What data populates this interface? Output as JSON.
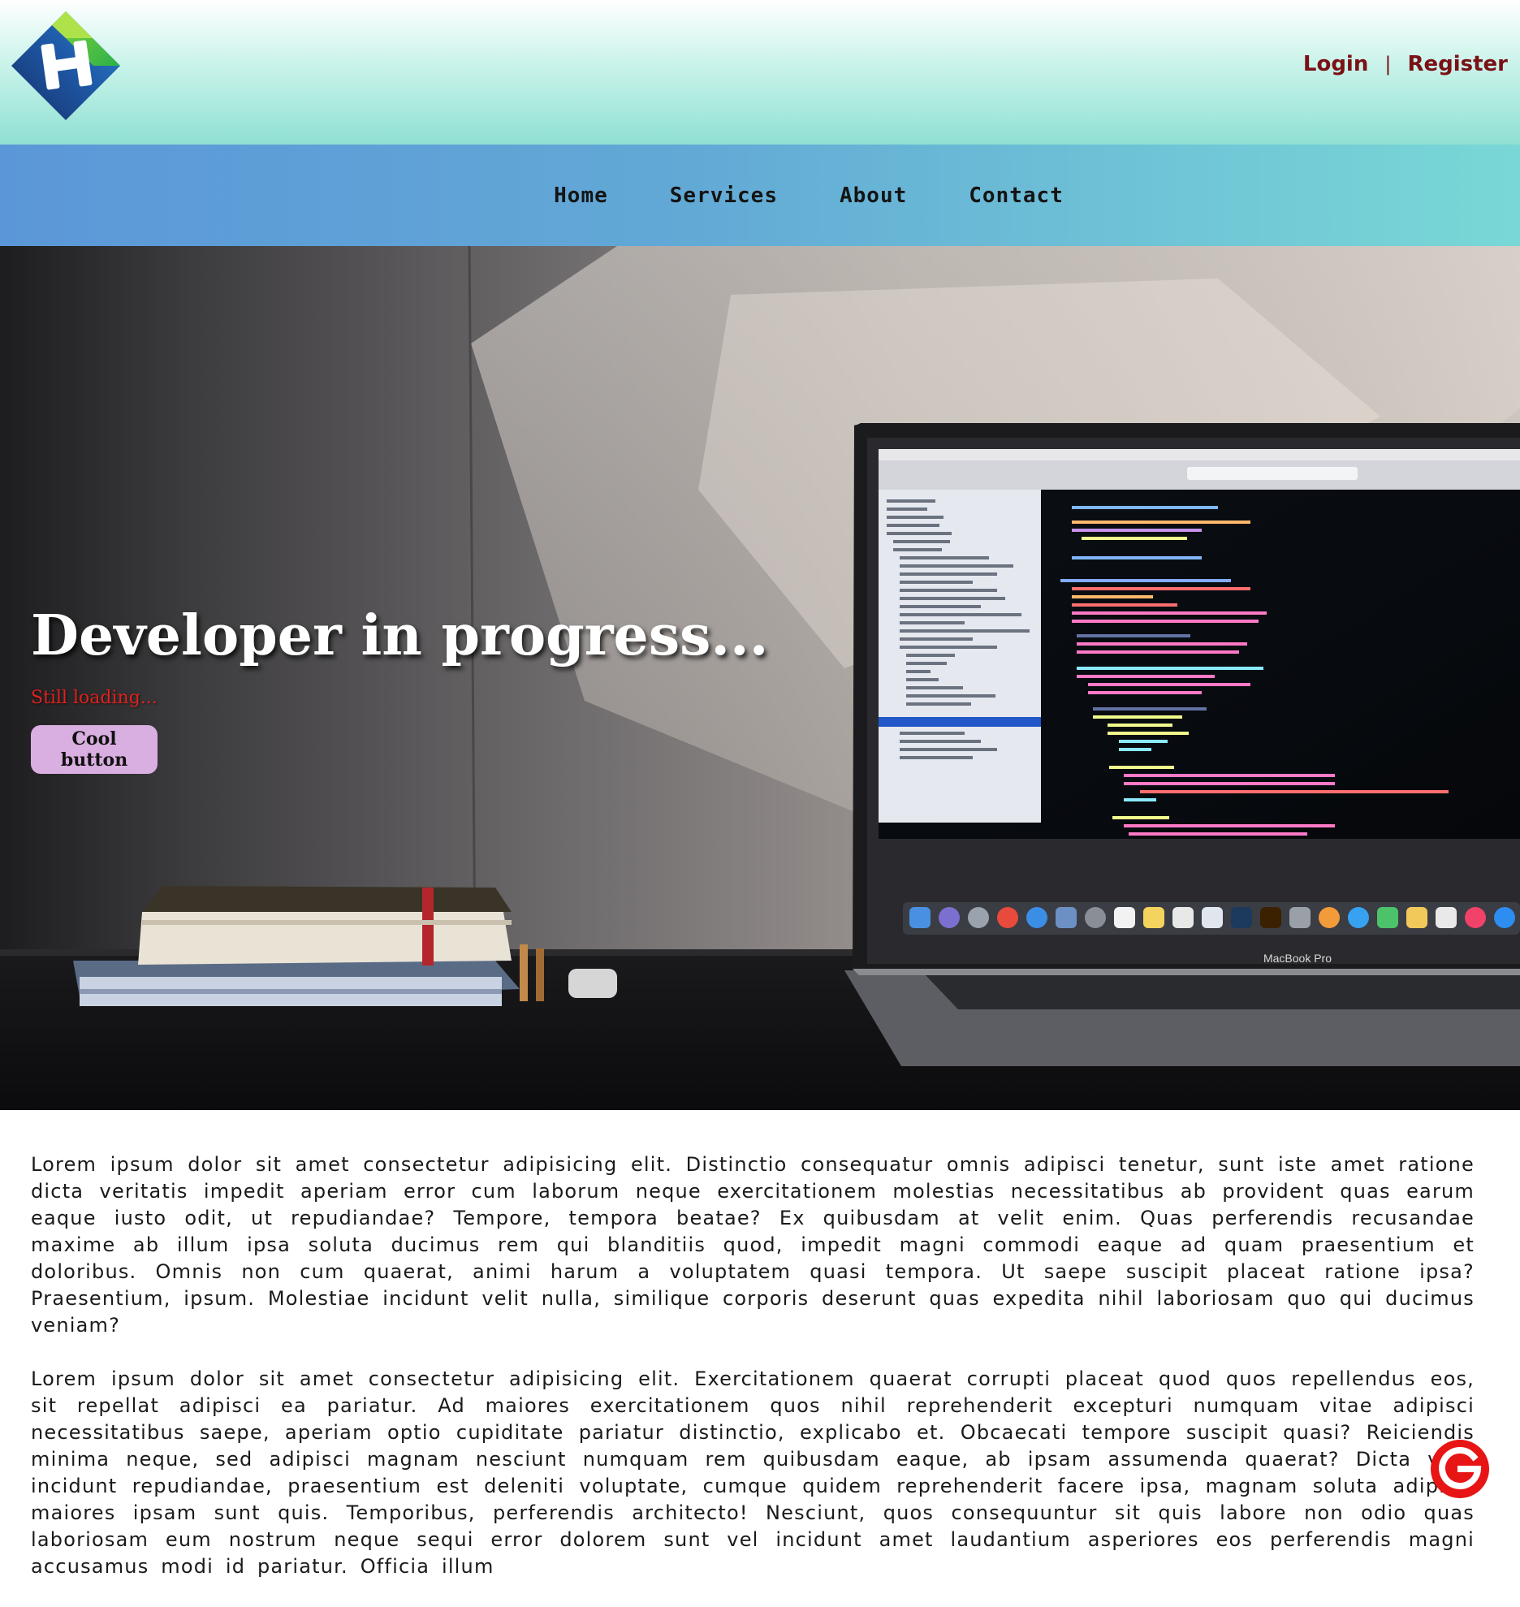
{
  "header": {
    "login_label": "Login",
    "separator": "|",
    "register_label": "Register"
  },
  "nav": {
    "items": [
      {
        "label": "Home"
      },
      {
        "label": "Services"
      },
      {
        "label": "About"
      },
      {
        "label": "Contact"
      }
    ]
  },
  "hero": {
    "title": "Developer in progress...",
    "subtitle": "Still loading...",
    "button_label": "Cool button",
    "laptop_brand": "MacBook Pro"
  },
  "content": {
    "paragraphs": [
      "Lorem ipsum dolor sit amet consectetur adipisicing elit. Distinctio consequatur omnis adipisci tenetur, sunt iste amet ratione dicta veritatis impedit aperiam error cum laborum neque exercitationem molestias necessitatibus ab provident quas earum eaque iusto odit, ut repudiandae? Tempore, tempora beatae? Ex quibusdam at velit enim. Quas perferendis recusandae maxime ab illum ipsa soluta ducimus rem qui blanditiis quod, impedit magni commodi eaque ad quam praesentium et doloribus. Omnis non cum quaerat, animi harum a voluptatem quasi tempora. Ut saepe suscipit placeat ratione ipsa? Praesentium, ipsum. Molestiae incidunt velit nulla, similique corporis deserunt quas expedita nihil laboriosam quo qui ducimus veniam?",
      "Lorem ipsum dolor sit amet consectetur adipisicing elit. Exercitationem quaerat corrupti placeat quod quos repellendus eos, sit repellat adipisci ea pariatur. Ad maiores exercitationem quos nihil reprehenderit excepturi numquam vitae adipisci necessitatibus saepe, aperiam optio cupiditate pariatur distinctio, explicabo et. Obcaecati tempore suscipit quasi? Reiciendis minima neque, sed adipisci magnam nesciunt numquam rem quibusdam eaque, ab ipsam assumenda quaerat? Dicta vero incidunt repudiandae, praesentium est deleniti voluptate, cumque quidem reprehenderit facere ipsa, magnam soluta adipisci maiores ipsam sunt quis. Temporibus, perferendis architecto! Nesciunt, quos consequuntur sit quis labore non odio quas laboriosam eum nostrum neque sequi error dolorem sunt vel incidunt amet laudantium asperiores eos perferendis magni accusamus modi id pariatur. Officia illum"
    ]
  },
  "badge": {
    "letter": "G"
  },
  "colors": {
    "auth_link": "#7a1114",
    "subtitle": "#e0211d",
    "button_bg": "#d9aee0",
    "badge_bg": "#e81515"
  },
  "icons": {
    "logo": "site-logo",
    "badge": "g-badge-icon"
  }
}
